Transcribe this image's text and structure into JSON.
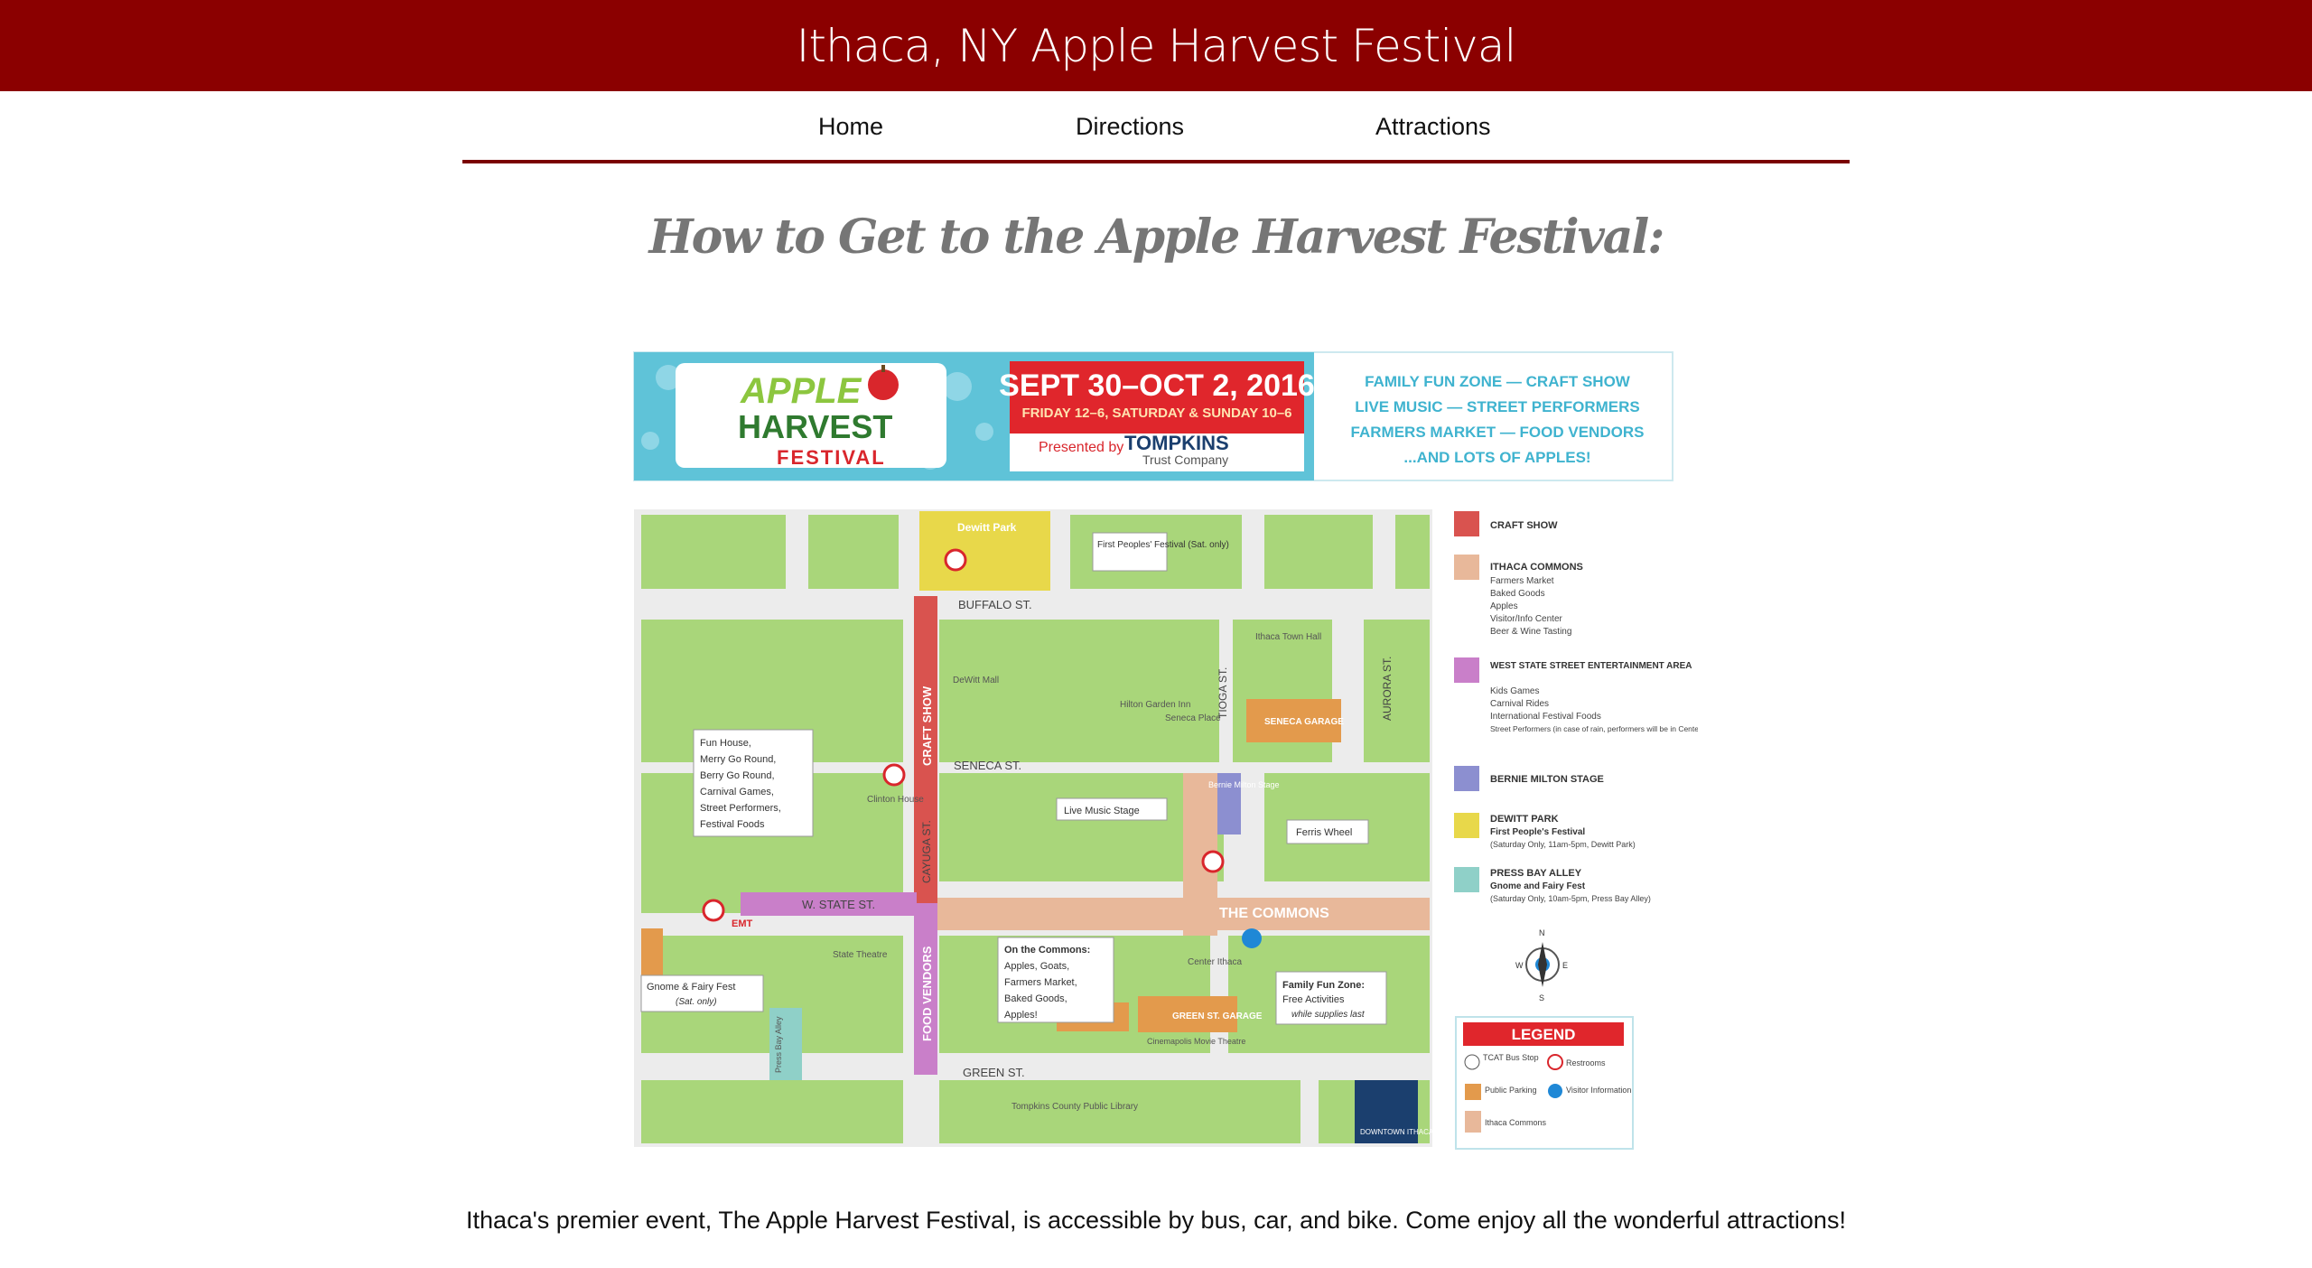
{
  "site": {
    "title": "Ithaca, NY Apple Harvest Festival"
  },
  "nav": {
    "items": [
      {
        "label": "Home"
      },
      {
        "label": "Directions"
      },
      {
        "label": "Attractions"
      }
    ]
  },
  "main": {
    "heading": "How to Get to the Apple Harvest Festival:",
    "caption": "Ithaca's premier event, The Apple Harvest Festival, is accessible by bus, car, and bike. Come enjoy all the wonderful attractions!"
  },
  "map": {
    "banner": {
      "logo_apple": "APPLE",
      "logo_harvest": "HARVEST",
      "logo_festival": "FESTIVAL",
      "dates": "SEPT 30–OCT 2, 2016",
      "hours": "FRIDAY 12–6, SATURDAY & SUNDAY 10–6",
      "presented_by": "Presented by",
      "sponsor": "TOMPKINS",
      "sponsor_sub": "Trust Company",
      "highlights": [
        "FAMILY FUN ZONE — CRAFT SHOW",
        "LIVE MUSIC — STREET PERFORMERS",
        "FARMERS MARKET — FOOD VENDORS",
        "...AND LOTS OF APPLES!"
      ]
    },
    "streets": {
      "buffalo": "BUFFALO ST.",
      "seneca": "SENECA ST.",
      "state": "W. STATE ST.",
      "green": "GREEN ST.",
      "cayuga": "CAYUGA ST.",
      "tioga": "TIOGA ST.",
      "aurora": "AURORA ST."
    },
    "places": {
      "dewitt_park": "Dewitt Park",
      "dewitt_mall": "DeWitt Mall",
      "hilton": "Hilton Garden Inn",
      "seneca_place": "Seneca Place",
      "town_hall": "Ithaca Town Hall",
      "seneca_garage": "SENECA GARAGE",
      "clinton_house": "Clinton House",
      "bernie_stage": "Bernie Milton Stage",
      "state_theatre": "State Theatre",
      "the_commons": "THE COMMONS",
      "center_ithaca": "Center Ithaca",
      "green_garage": "GREEN ST. GARAGE",
      "cinemapolis": "Cinemapolis Movie Theatre",
      "library": "Tompkins County Public Library",
      "press_bay": "Press Bay Alley",
      "craft_show_street": "CRAFT SHOW",
      "food_vendors_street": "FOOD VENDORS",
      "emt": "EMT",
      "downtown": "DOWNTOWN ITHACA"
    },
    "callouts": {
      "first_peoples": "First Peoples' Festival (Sat. only)",
      "fun_house": [
        "Fun House,",
        "Merry Go Round,",
        "Berry Go Round,",
        "Carnival Games,",
        "Street Performers,",
        "Festival Foods"
      ],
      "live_music": "Live Music Stage",
      "ferris_wheel": "Ferris Wheel",
      "gnome_fairy": "Gnome & Fairy Fest",
      "gnome_fairy_note": "(Sat. only)",
      "on_commons_title": "On the Commons:",
      "on_commons": [
        "Apples, Goats,",
        "Farmers Market,",
        "Baked Goods,",
        "Apples!"
      ],
      "family_fun_title": "Family Fun Zone:",
      "family_fun": "Free Activities",
      "family_fun_note": "while supplies last"
    },
    "key": [
      {
        "color": "#d9534f",
        "title": "CRAFT SHOW",
        "lines": []
      },
      {
        "color": "#e8b89a",
        "title": "ITHACA COMMONS",
        "lines": [
          "Farmers Market",
          "Baked Goods",
          "Apples",
          "Visitor/Info Center",
          "Beer & Wine Tasting"
        ]
      },
      {
        "color": "#c97fc9",
        "title": "WEST STATE STREET ENTERTAINMENT AREA",
        "lines": [
          "Kids Games",
          "Carnival Rides",
          "International Festival Foods",
          "Street Performers (in case of rain, performers will be in Center Ithaca)"
        ]
      },
      {
        "color": "#8c8fd0",
        "title": "BERNIE MILTON STAGE",
        "lines": []
      },
      {
        "color": "#e8d84a",
        "title": "DEWITT PARK",
        "lines": [
          "First People's Festival",
          "(Saturday Only, 11am-5pm, Dewitt Park)"
        ]
      },
      {
        "color": "#8fd0c8",
        "title": "PRESS BAY ALLEY",
        "lines": [
          "Gnome and Fairy Fest",
          "(Saturday Only, 10am-5pm, Press Bay Alley)"
        ]
      }
    ],
    "legend": {
      "title": "LEGEND",
      "bus": "TCAT Bus Stop",
      "restrooms": "Restrooms",
      "parking": "Public Parking",
      "info": "Visitor Information",
      "commons": "Ithaca Commons"
    },
    "compass": {
      "n": "N",
      "s": "S",
      "e": "E",
      "w": "W"
    },
    "colors": {
      "brand": "#8b0000",
      "block": "#a9d67a",
      "street": "#ececec",
      "craft": "#d9534f",
      "commons": "#e8b89a",
      "state_street": "#c97fc9",
      "stage": "#8c8fd0",
      "park": "#e8d84a",
      "alley": "#8fd0c8",
      "garage": "#e39a4c"
    }
  }
}
